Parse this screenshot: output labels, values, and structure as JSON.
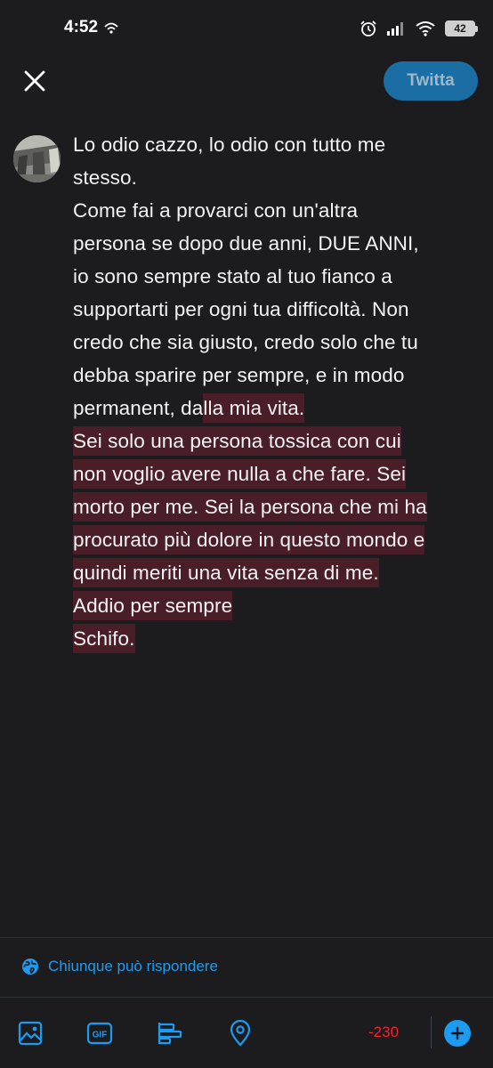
{
  "status_bar": {
    "time": "4:52",
    "battery": "42",
    "icons": [
      "hotspot-icon",
      "alarm-icon",
      "signal-icon",
      "wifi-icon",
      "battery-icon"
    ]
  },
  "header": {
    "close_icon": "close-icon",
    "tweet_label": "Twitta"
  },
  "composer": {
    "lines": [
      "Lo odio cazzo, lo odio con tutto me",
      "stesso.",
      "Come fai a provarci con un'altra",
      "persona se dopo due anni, DUE ANNI,",
      "io sono sempre stato al tuo fianco a",
      "supportarti per ogni tua difficoltà. Non",
      "credo che sia giusto, credo solo che tu",
      "debba sparire per sempre, e in modo"
    ],
    "line_9_normal": "permanent, da",
    "line_9_highlighted": "lla mia vita.",
    "highlighted_lines": [
      "Sei solo una persona tossica con cui",
      "non voglio avere nulla a che fare. Sei",
      "morto per me. Sei la persona che mi ha",
      "procurato più dolore in questo mondo e",
      "quindi meriti una vita senza di me.",
      "Addio per sempre",
      "Schifo."
    ],
    "highlight_color": "#4a1e29"
  },
  "reply_setting": {
    "icon": "globe-icon",
    "label": "Chiunque può rispondere"
  },
  "toolbar": {
    "icons": [
      "image-icon",
      "gif-icon",
      "poll-icon",
      "location-icon",
      "add-icon"
    ],
    "gif_label": "GIF",
    "char_count": "-230"
  },
  "colors": {
    "accent": "#1d9bf0",
    "background": "#1c1c1e",
    "over_limit": "#f4212e"
  }
}
